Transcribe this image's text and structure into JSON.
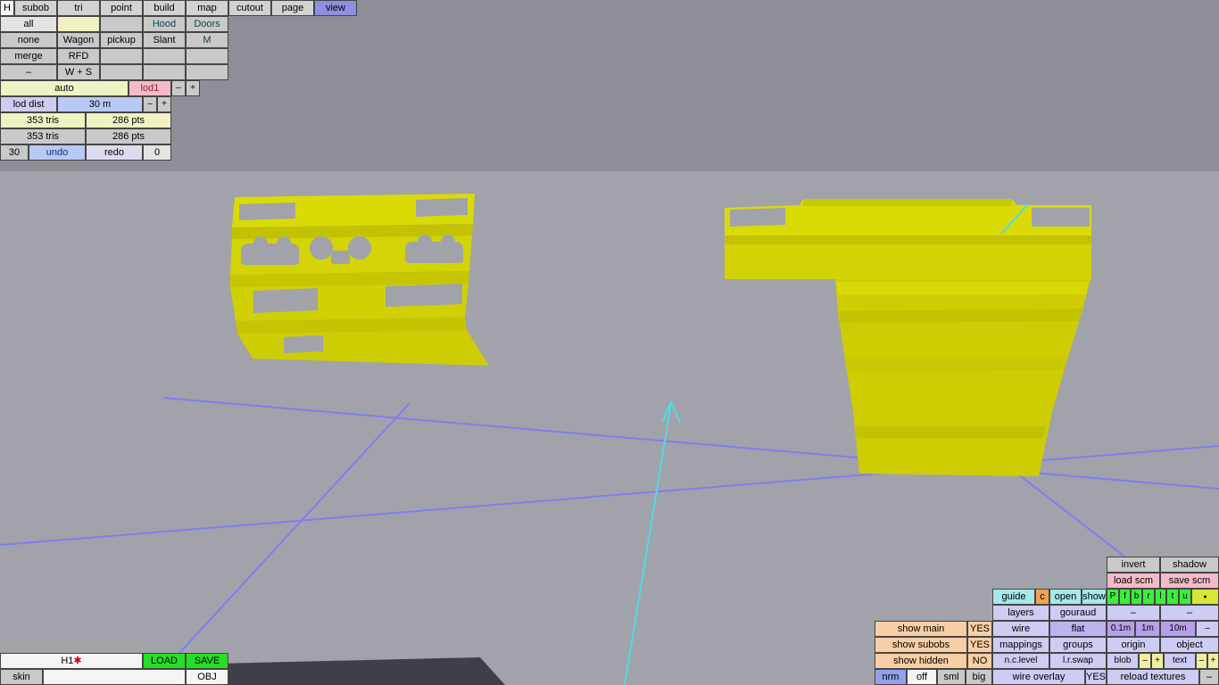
{
  "colors": {
    "bg_top": "#8e8e96",
    "bg_bottom": "#a2a2aa",
    "grid": "#7b7bff",
    "arrow": "#4fdbe4",
    "model_yellow": "#d2d204"
  },
  "menu": {
    "r1": [
      "H",
      "subob",
      "tri",
      "point",
      "build",
      "map",
      "cutout",
      "page",
      "view"
    ],
    "r2": [
      "all",
      "",
      "",
      "Hood",
      "Doors"
    ],
    "r3": [
      "none",
      "Wagon",
      "pickup",
      "Slant",
      "M"
    ],
    "r4": [
      "merge",
      "RFD",
      "",
      "",
      ""
    ],
    "r5": [
      "–",
      "W + S",
      "",
      "",
      ""
    ]
  },
  "lod": {
    "auto": "auto",
    "lod1": "lod1",
    "minus": "–",
    "plus": "+",
    "dist_label": "lod dist",
    "dist_value": "30 m",
    "tris1": "353 tris",
    "pts1": "286 pts",
    "tris2": "353 tris",
    "pts2": "286 pts",
    "undo_steps": "30",
    "undo": "undo",
    "redo": "redo",
    "redo_steps": "0"
  },
  "file": {
    "name": "H1",
    "modified_marker": "✱",
    "load": "LOAD",
    "save": "SAVE",
    "skin": "skin",
    "obj": "OBJ"
  },
  "panel": {
    "invert": "invert",
    "shadow": "shadow",
    "load_scm": "load scm",
    "save_scm": "save scm",
    "guide": "guide",
    "c": "c",
    "open": "open",
    "show": "show",
    "faces": [
      "P",
      "f",
      "b",
      "r",
      "l",
      "t",
      "u"
    ],
    "dot": "●",
    "layers": "layers",
    "gouraud": "gouraud",
    "dash": "–",
    "show_main": "show main",
    "show_main_val": "YES",
    "wire": "wire",
    "flat": "flat",
    "g01": "0.1m",
    "g1": "1m",
    "g10": "10m",
    "show_subobs": "show subobs",
    "show_subobs_val": "YES",
    "mappings": "mappings",
    "groups": "groups",
    "origin": "origin",
    "object": "object",
    "show_hidden": "show hidden",
    "show_hidden_val": "NO",
    "nclevel": "n.c.level",
    "lrswap": "l.r.swap",
    "blob": "blob",
    "text": "text",
    "nrm": "nrm",
    "off": "off",
    "sml": "sml",
    "big": "big",
    "wire_overlay": "wire overlay",
    "wire_overlay_val": "YES",
    "reload_textures": "reload textures"
  }
}
